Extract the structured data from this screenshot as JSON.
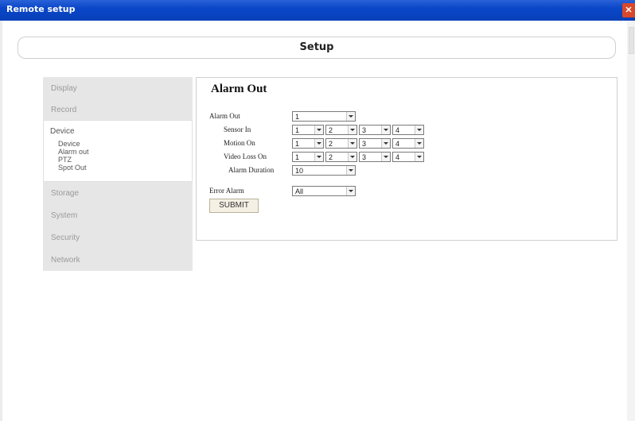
{
  "window": {
    "title": "Remote setup",
    "close_label": "✕"
  },
  "header": {
    "title": "Setup"
  },
  "nav": {
    "items": [
      {
        "label": "Display"
      },
      {
        "label": "Record"
      },
      {
        "label": "Storage"
      },
      {
        "label": "System"
      },
      {
        "label": "Security"
      },
      {
        "label": "Network"
      }
    ],
    "device": {
      "label": "Device",
      "subitems": [
        "Device",
        "Alarm out",
        "PTZ",
        "Spot Out"
      ]
    }
  },
  "panel": {
    "title": "Alarm Out",
    "alarm_out": {
      "label": "Alarm Out",
      "value": "1"
    },
    "sensor_in": {
      "label": "Sensor In",
      "values": [
        "1",
        "2",
        "3",
        "4"
      ]
    },
    "motion_on": {
      "label": "Motion On",
      "values": [
        "1",
        "2",
        "3",
        "4"
      ]
    },
    "video_loss_on": {
      "label": "Video Loss On",
      "values": [
        "1",
        "2",
        "3",
        "4"
      ]
    },
    "alarm_duration": {
      "label": "Alarm Duration",
      "value": "10"
    },
    "error_alarm": {
      "label": "Error Alarm",
      "value": "All"
    },
    "submit_label": "SUBMIT"
  }
}
